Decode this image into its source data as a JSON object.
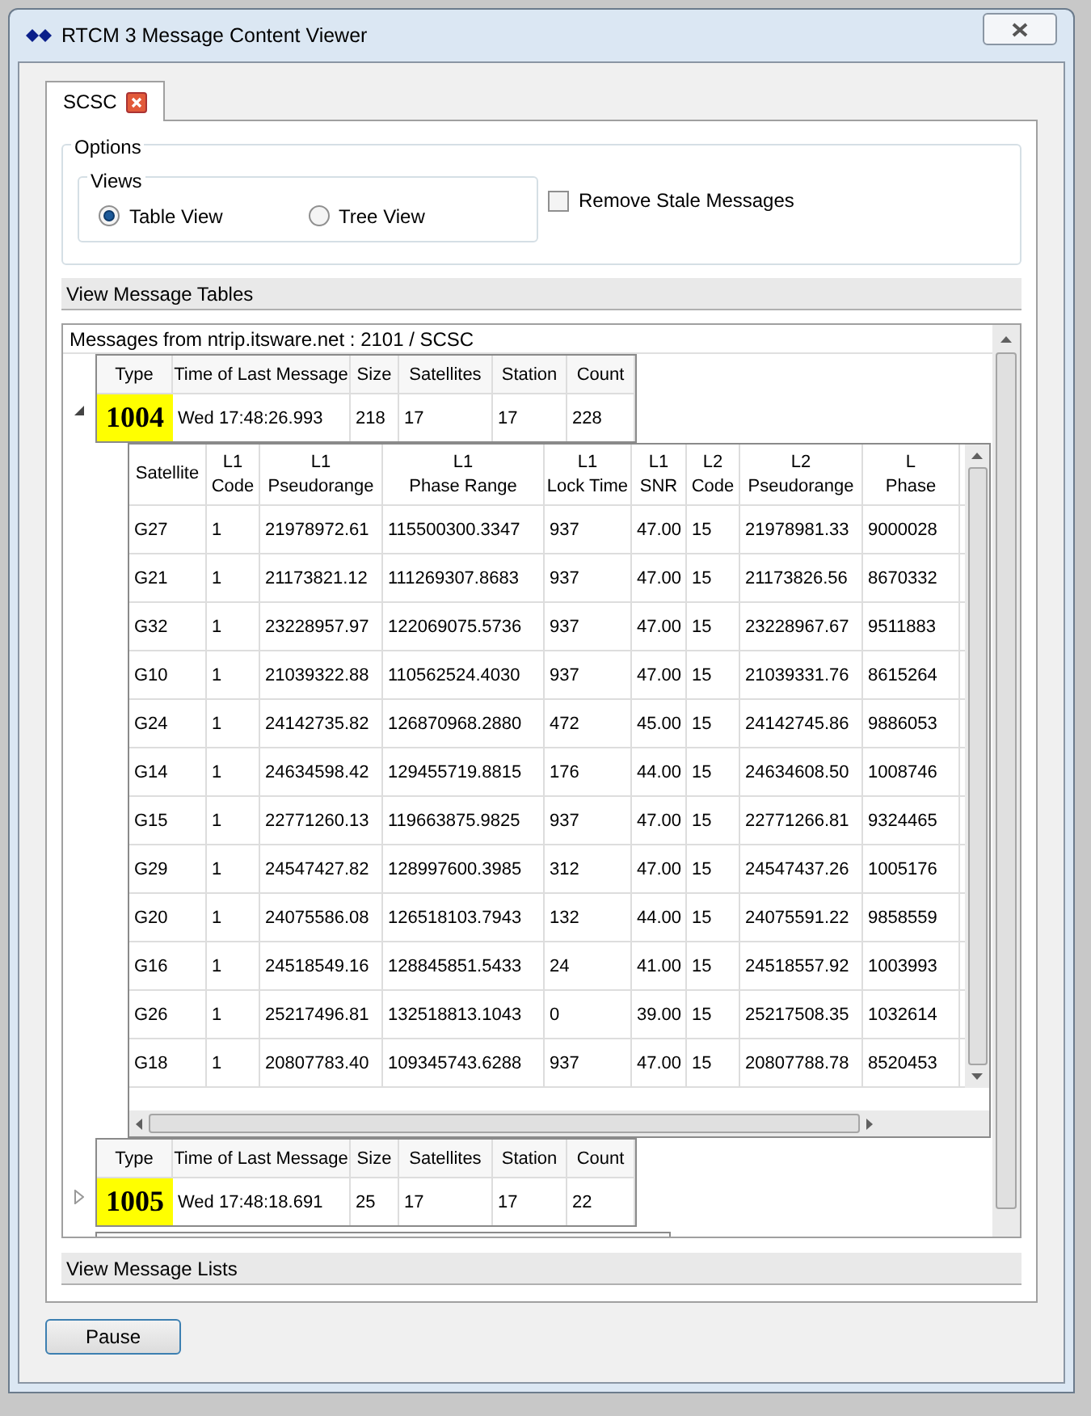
{
  "window": {
    "title": "RTCM 3 Message Content Viewer"
  },
  "tabs": [
    {
      "label": "SCSC",
      "selected": true
    }
  ],
  "options": {
    "title": "Options",
    "views": {
      "title": "Views",
      "radios": [
        {
          "label": "Table View",
          "selected": true
        },
        {
          "label": "Tree View",
          "selected": false
        }
      ]
    },
    "remove_stale": {
      "label": "Remove Stale Messages",
      "checked": false
    }
  },
  "sections": [
    {
      "label": "View Message Tables"
    }
  ],
  "message_tree": {
    "header": "Messages from ntrip.itsware.net : 2101 / SCSC",
    "messages": [
      {
        "expanded": true,
        "columns": [
          "Type",
          "Time of Last Message",
          "Size",
          "Satellites",
          "Station",
          "Count"
        ],
        "cells": [
          "1004",
          "Wed 17:48:26.993",
          "218",
          "17",
          "17",
          "228"
        ],
        "detail": {
          "columns": [
            "Satellite",
            "L1\nCode",
            "L1\nPseudorange",
            "L1\nPhase Range",
            "L1\nLock Time",
            "L1\nSNR",
            "L2\nCode",
            "L2\nPseudorange",
            "L\nPhase"
          ],
          "rows": [
            [
              "G27",
              "1",
              "21978972.61",
              "115500300.3347",
              "937",
              "47.00",
              "15",
              "21978981.33",
              "9000028"
            ],
            [
              "G21",
              "1",
              "21173821.12",
              "111269307.8683",
              "937",
              "47.00",
              "15",
              "21173826.56",
              "8670332"
            ],
            [
              "G32",
              "1",
              "23228957.97",
              "122069075.5736",
              "937",
              "47.00",
              "15",
              "23228967.67",
              "9511883"
            ],
            [
              "G10",
              "1",
              "21039322.88",
              "110562524.4030",
              "937",
              "47.00",
              "15",
              "21039331.76",
              "8615264"
            ],
            [
              "G24",
              "1",
              "24142735.82",
              "126870968.2880",
              "472",
              "45.00",
              "15",
              "24142745.86",
              "9886053"
            ],
            [
              "G14",
              "1",
              "24634598.42",
              "129455719.8815",
              "176",
              "44.00",
              "15",
              "24634608.50",
              "1008746"
            ],
            [
              "G15",
              "1",
              "22771260.13",
              "119663875.9825",
              "937",
              "47.00",
              "15",
              "22771266.81",
              "9324465"
            ],
            [
              "G29",
              "1",
              "24547427.82",
              "128997600.3985",
              "312",
              "47.00",
              "15",
              "24547437.26",
              "1005176"
            ],
            [
              "G20",
              "1",
              "24075586.08",
              "126518103.7943",
              "132",
              "44.00",
              "15",
              "24075591.22",
              "9858559"
            ],
            [
              "G16",
              "1",
              "24518549.16",
              "128845851.5433",
              "24",
              "41.00",
              "15",
              "24518557.92",
              "1003993"
            ],
            [
              "G26",
              "1",
              "25217496.81",
              "132518813.1043",
              "0",
              "39.00",
              "15",
              "25217508.35",
              "1032614"
            ],
            [
              "G18",
              "1",
              "20807783.40",
              "109345743.6288",
              "937",
              "47.00",
              "15",
              "20807788.78",
              "8520453"
            ]
          ]
        }
      },
      {
        "expanded": false,
        "columns": [
          "Type",
          "Time of Last Message",
          "Size",
          "Satellites",
          "Station",
          "Count"
        ],
        "cells": [
          "1005",
          "Wed 17:48:18.691",
          "25",
          "17",
          "17",
          "22"
        ]
      }
    ]
  },
  "sections_bottom": [
    {
      "label": "View Message Lists"
    }
  ],
  "buttons": [
    {
      "label": "Pause"
    }
  ]
}
